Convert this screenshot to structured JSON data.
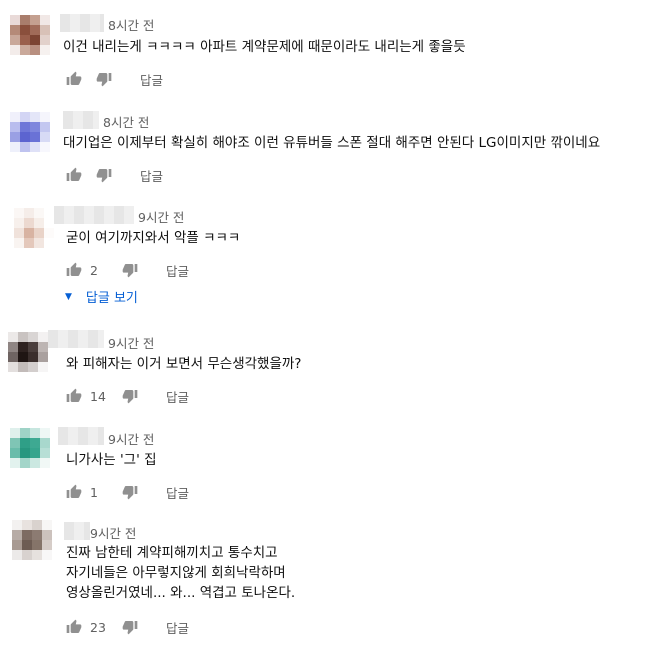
{
  "comments": [
    {
      "time": "8시간 전",
      "lines": [
        "이건 내리는게 ㅋㅋㅋㅋ 아파트 계약문제에 때문이라도 내리는게 좋을듯"
      ],
      "likes": "",
      "reply": "답글",
      "avatar_colors": [
        "#e9dad8",
        "#a97d6c",
        "#c4a090",
        "#f1e8e6",
        "#b58a78",
        "#8a4f3c",
        "#a06b59",
        "#d8c1b7",
        "#c9a89a",
        "#9a5f4c",
        "#7c4433",
        "#e2d1cb",
        "#f3ecea",
        "#caa99b",
        "#b88f80",
        "#f6f1ef"
      ]
    },
    {
      "time": "8시간 전",
      "lines": [
        "대기업은 이제부터 확실히 해야조 이런 유튜버들 스폰 절대 해주면 안된다 LG이미지만 깎이네요"
      ],
      "likes": "",
      "reply": "답글",
      "avatar_colors": [
        "#f0f0fb",
        "#d3d5f4",
        "#e4e6f8",
        "#f5f5fc",
        "#b9bdee",
        "#6f77d8",
        "#7e86dd",
        "#c3c7f0",
        "#9aa0e4",
        "#5c64d0",
        "#6a72d6",
        "#d7daf5",
        "#eef0fb",
        "#bfc3ef",
        "#dfe1f7",
        "#f7f7fd"
      ]
    },
    {
      "time": "9시간 전",
      "lines": [
        "굳이 여기까지와서 악플 ㅋㅋㅋ"
      ],
      "likes": "2",
      "reply": "답글",
      "view_replies": "답글 보기",
      "avatar_colors": [
        "#fbf7f5",
        "#f5ede9",
        "#fbf8f6",
        "#ffffff",
        "#f7f0ec",
        "#ecd9d0",
        "#f6eee9",
        "#ffffff",
        "#f0e2db",
        "#d8b3a2",
        "#e9d3c8",
        "#fdfbfa",
        "#f9f4f1",
        "#e4c8bb",
        "#f2e6e0",
        "#ffffff"
      ]
    },
    {
      "time": "9시간 전",
      "lines": [
        "와 피해자는 이거 보면서 무슨생각했을까?"
      ],
      "likes": "14",
      "reply": "답글",
      "avatar_colors": [
        "#ece9e8",
        "#c9c3c1",
        "#d9d5d4",
        "#f3f1f1",
        "#8f8583",
        "#2e2220",
        "#4a3e3c",
        "#bdb5b3",
        "#6f6462",
        "#1f1513",
        "#3a2e2c",
        "#a9a09e",
        "#e3dfde",
        "#c2bbb9",
        "#d3cecd",
        "#f6f5f5"
      ]
    },
    {
      "time": "9시간 전",
      "lines": [
        "니가사는 '그' 집"
      ],
      "likes": "1",
      "reply": "답글",
      "avatar_colors": [
        "#dff0ec",
        "#9fd3c7",
        "#c7e6df",
        "#eef7f5",
        "#7fc5b5",
        "#2f9f87",
        "#3ea992",
        "#a8d8cd",
        "#69bcaa",
        "#27977f",
        "#36a58d",
        "#b7dfd6",
        "#e2f2ee",
        "#a3d5c9",
        "#cbe8e1",
        "#f1f8f6"
      ]
    },
    {
      "time": "9시간 전",
      "lines": [
        "진짜 남한테 계약피해끼치고 통수치고",
        "자기네들은 아무렇지않게 회희낙락하며",
        "영상올린거였네... 와... 역겹고 토나온다."
      ],
      "likes": "23",
      "reply": "답글",
      "avatar_colors": [
        "#f3f1f0",
        "#e8e2df",
        "#d9d2ce",
        "#f7f6f5",
        "#b7aca6",
        "#7d6b62",
        "#8c7b72",
        "#ccc2bd",
        "#a89a92",
        "#6d5c53",
        "#857469",
        "#d6cdc8",
        "#eceae9",
        "#d8d2cf",
        "#e6e1de",
        "#f8f7f7"
      ]
    }
  ]
}
